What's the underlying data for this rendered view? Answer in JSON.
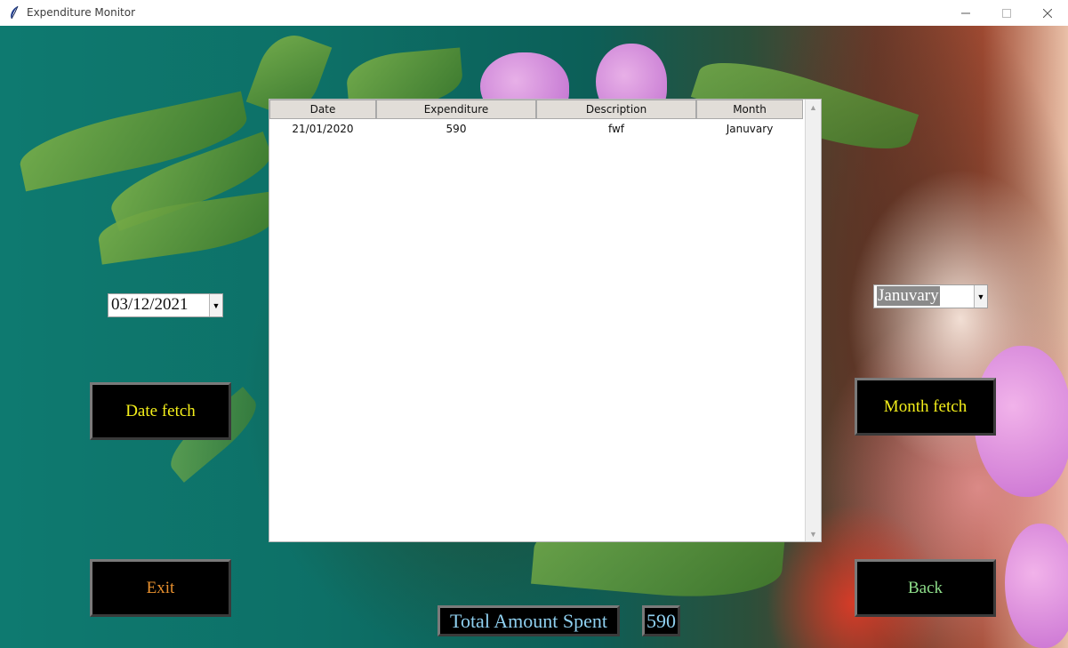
{
  "window": {
    "title": "Expenditure Monitor",
    "controls": [
      "minimize",
      "maximize",
      "close"
    ]
  },
  "table": {
    "columns": [
      "Date",
      "Expenditure",
      "Description",
      "Month"
    ],
    "rows": [
      [
        "21/01/2020",
        "590",
        "fwf",
        "Januvary"
      ]
    ]
  },
  "date_picker": {
    "value": "03/12/2021"
  },
  "month_picker": {
    "value": "Januvary"
  },
  "buttons": {
    "date_fetch": "Date fetch",
    "month_fetch": "Month fetch",
    "exit": "Exit",
    "back": "Back"
  },
  "total": {
    "label": "Total Amount Spent",
    "value": "590"
  },
  "colors": {
    "button_bg": "#000000",
    "fetch_text": "#f4ef1a",
    "exit_text": "#e8902e",
    "back_text": "#8ede8a",
    "total_text": "#8fd0f0"
  },
  "icons": {
    "app": "feather-icon",
    "dropdown": "chevron-down-icon"
  }
}
